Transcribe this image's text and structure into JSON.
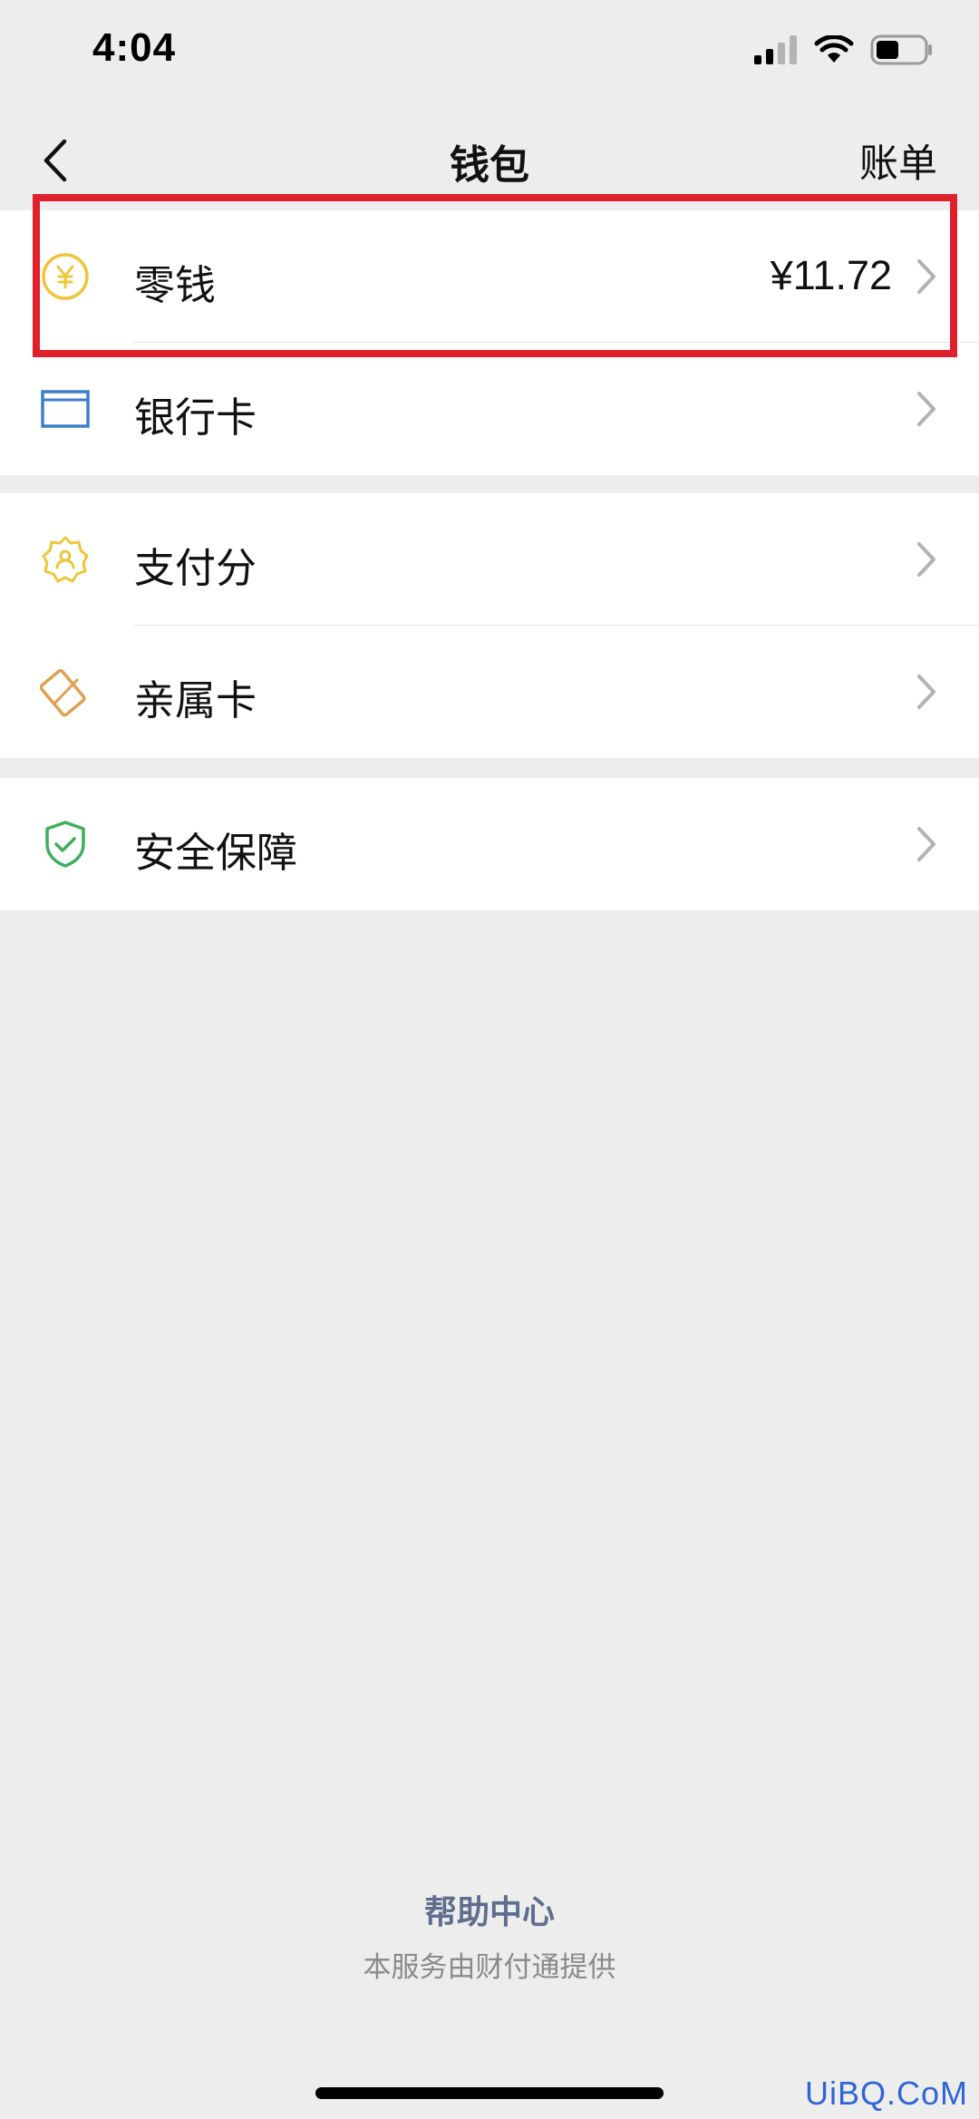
{
  "status_bar": {
    "time": "4:04",
    "icons": [
      "signal-icon",
      "wifi-icon",
      "battery-icon"
    ]
  },
  "nav": {
    "back_icon": "chevron-left-icon",
    "title": "钱包",
    "right_label": "账单"
  },
  "groups": [
    {
      "items": [
        {
          "label": "零钱",
          "value": "¥11.72",
          "icon": "yuan-coin-icon",
          "highlighted": true
        },
        {
          "label": "银行卡",
          "value": "",
          "icon": "bank-card-icon"
        }
      ]
    },
    {
      "items": [
        {
          "label": "支付分",
          "value": "",
          "icon": "pay-score-badge-icon"
        },
        {
          "label": "亲属卡",
          "value": "",
          "icon": "family-card-icon"
        }
      ]
    },
    {
      "items": [
        {
          "label": "安全保障",
          "value": "",
          "icon": "shield-check-icon"
        }
      ]
    }
  ],
  "footer": {
    "help_link": "帮助中心",
    "provider_note": "本服务由财付通提供"
  },
  "watermark": "UiBQ.CoM",
  "colors": {
    "background": "#ededed",
    "highlight": "#e0202a",
    "coin": "#f0c43a",
    "card": "#3d7fc8",
    "family_card": "#e0a050",
    "shield": "#3fae5b",
    "link": "#5f6e8e"
  }
}
